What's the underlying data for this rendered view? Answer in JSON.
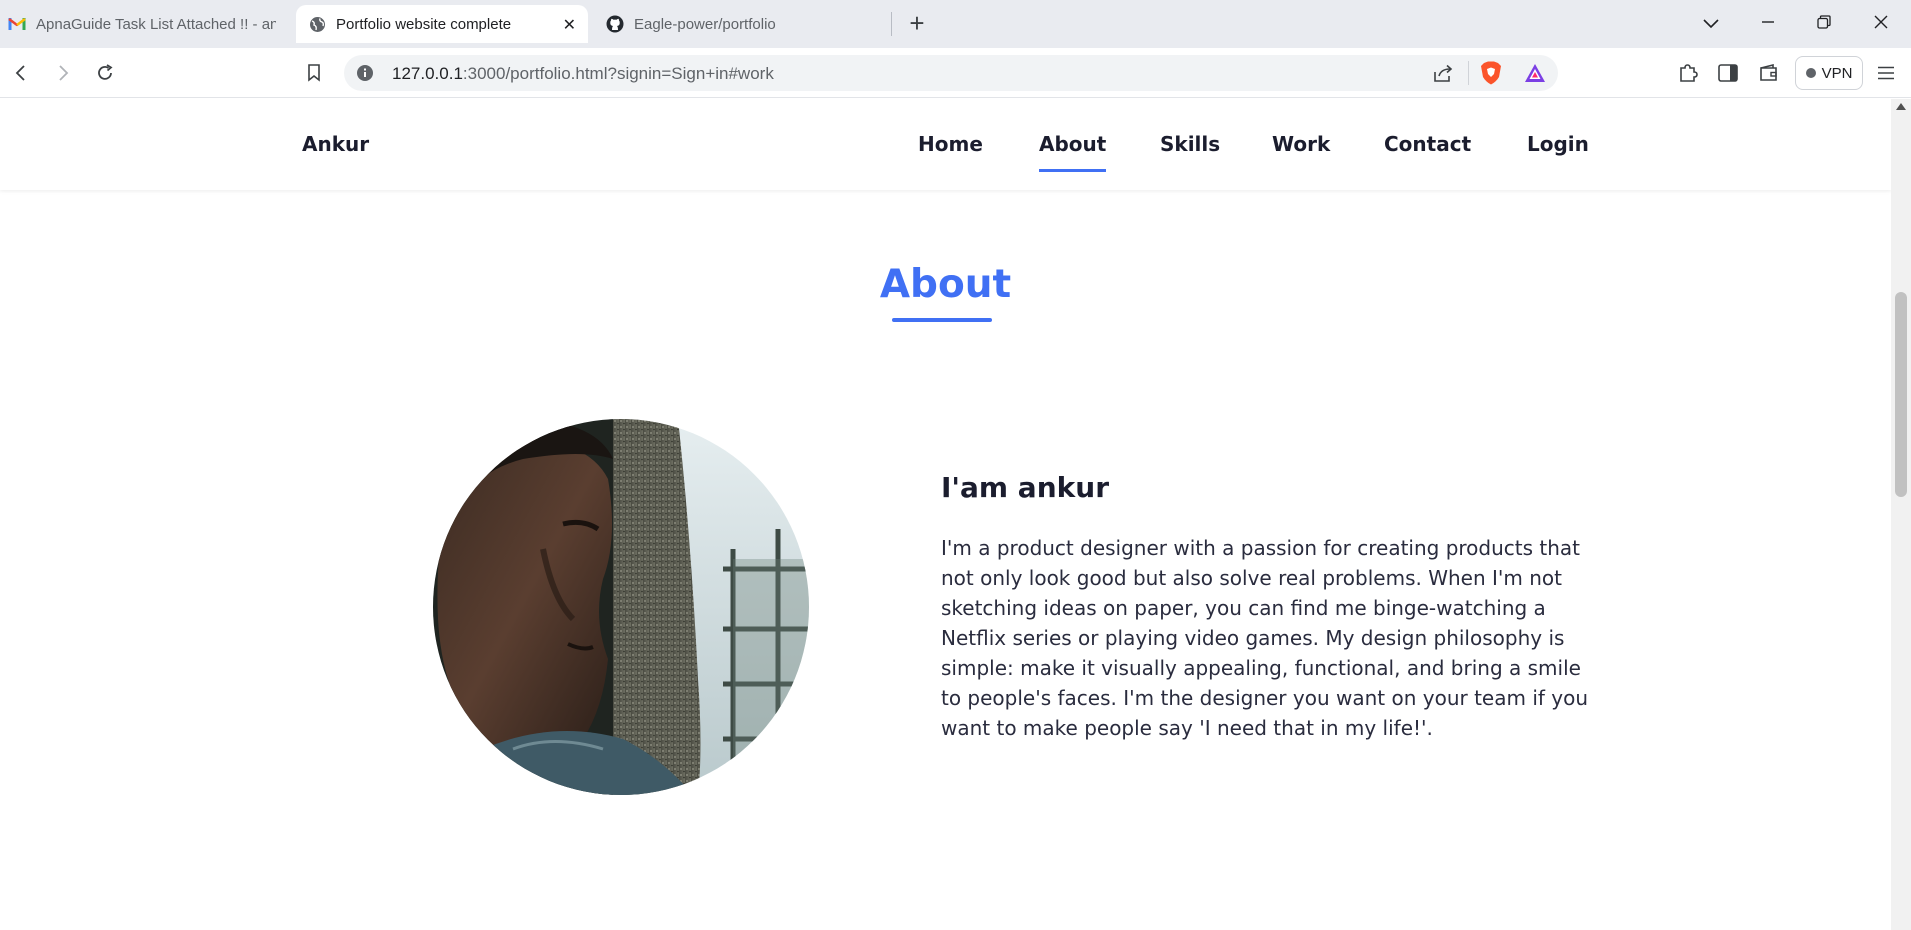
{
  "browser": {
    "tabs": [
      {
        "title": "ApnaGuide Task List Attached !! - ank",
        "icon": "gmail-icon",
        "active": false
      },
      {
        "title": "Portfolio website complete",
        "icon": "globe-icon",
        "active": true,
        "close": "✕"
      },
      {
        "title": "Eagle-power/portfolio",
        "icon": "github-icon",
        "active": false
      }
    ],
    "new_tab": "+",
    "url_host": "127.0.0.1",
    "url_rest": ":3000/portfolio.html?signin=Sign+in#work",
    "vpn_label": "VPN"
  },
  "site": {
    "logo": "Ankur",
    "nav": [
      {
        "label": "Home"
      },
      {
        "label": "About",
        "active": true
      },
      {
        "label": "Skills"
      },
      {
        "label": "Work"
      },
      {
        "label": "Contact"
      },
      {
        "label": "Login"
      }
    ],
    "section_title": "About",
    "heading": "I'am ankur",
    "paragraph": "I'm a product designer with a passion for creating products that not only look good but also solve real problems. When I'm not sketching ideas on paper, you can find me binge-watching a Netflix series or playing video games. My design philosophy is simple: make it visually appealing, functional, and bring a smile to people's faces. I'm the designer you want on your team if you want to make people say 'I need that in my life!'."
  },
  "colors": {
    "accent": "#4070f4",
    "text_dark": "#1b1d2e"
  }
}
